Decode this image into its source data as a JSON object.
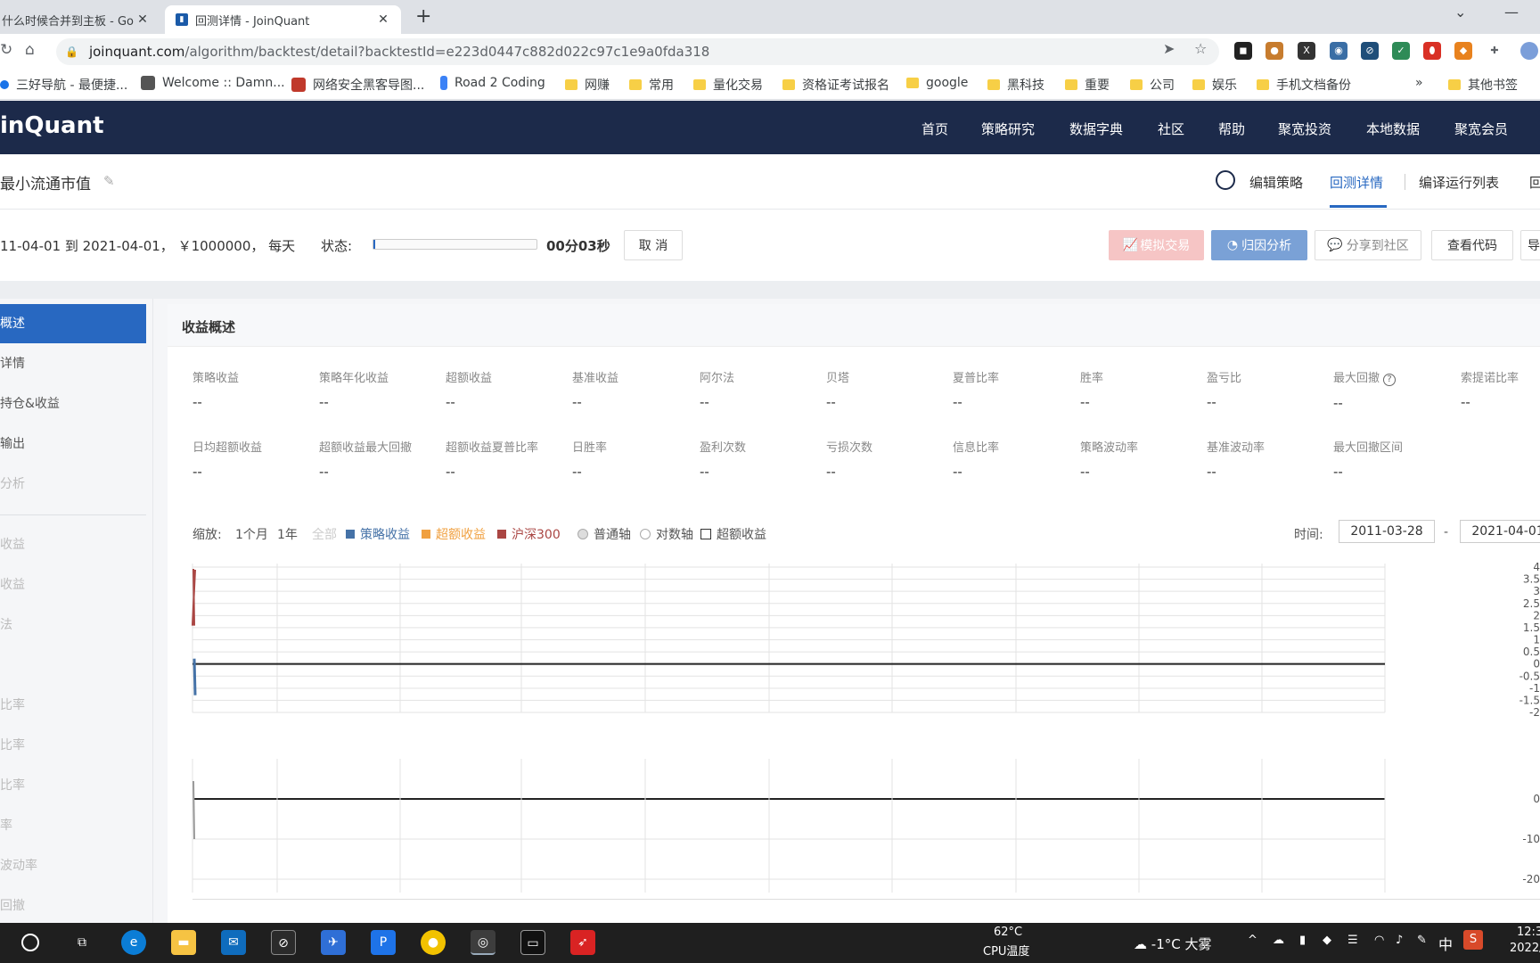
{
  "browser": {
    "tabs": [
      {
        "title": "什么时候合并到主板 - Go"
      },
      {
        "title": "回测详情 - JoinQuant"
      }
    ],
    "url_host": "joinquant.com",
    "url_path": "/algorithm/backtest/detail?backtestId=e223d0447c882d022c97c1e9a0fda318",
    "bookmarks": [
      "三好导航 - 最便捷...",
      "Welcome :: Damn...",
      "网络安全黑客导图...",
      "Road 2 Coding",
      "网赚",
      "常用",
      "量化交易",
      "资格证考试报名",
      "google",
      "黑科技",
      "重要",
      "公司",
      "娱乐",
      "手机文档备份",
      "其他书签"
    ],
    "more_bookmarks": "»"
  },
  "site": {
    "logo": "inQuant",
    "nav": [
      "首页",
      "策略研究",
      "数据字典",
      "社区",
      "帮助",
      "聚宽投资",
      "本地数据",
      "聚宽会员"
    ]
  },
  "strategy": {
    "title": "最小流通市值",
    "tabs": [
      "编辑策略",
      "回测详情",
      "编译运行列表",
      "回"
    ]
  },
  "controls": {
    "params": "11-04-01 到 2021-04-01， ￥1000000， 每天",
    "status_label": "状态:",
    "progress": 0.01,
    "elapsed": "00分03秒",
    "cancel": "取 消",
    "sim_trade": "模拟交易",
    "attribution": "归因分析",
    "share": "分享到社区",
    "view_code": "查看代码",
    "more": "导"
  },
  "sidebar": {
    "items": [
      "概述",
      "详情",
      "持仓&收益",
      "输出",
      "分析"
    ],
    "items2": [
      "收益",
      "收益",
      "法",
      "",
      "比率",
      "比率",
      "比率",
      "率",
      "波动率",
      "回撤"
    ]
  },
  "summary": {
    "title": "收益概述",
    "row1": [
      {
        "label": "策略收益",
        "value": "--"
      },
      {
        "label": "策略年化收益",
        "value": "--"
      },
      {
        "label": "超额收益",
        "value": "--"
      },
      {
        "label": "基准收益",
        "value": "--"
      },
      {
        "label": "阿尔法",
        "value": "--"
      },
      {
        "label": "贝塔",
        "value": "--"
      },
      {
        "label": "夏普比率",
        "value": "--"
      },
      {
        "label": "胜率",
        "value": "--"
      },
      {
        "label": "盈亏比",
        "value": "--"
      },
      {
        "label": "最大回撤",
        "value": "--"
      },
      {
        "label": "索提诺比率",
        "value": "--"
      }
    ],
    "row2": [
      {
        "label": "日均超额收益",
        "value": "--"
      },
      {
        "label": "超额收益最大回撤",
        "value": "--"
      },
      {
        "label": "超额收益夏普比率",
        "value": "--"
      },
      {
        "label": "日胜率",
        "value": "--"
      },
      {
        "label": "盈利次数",
        "value": "--"
      },
      {
        "label": "亏损次数",
        "value": "--"
      },
      {
        "label": "信息比率",
        "value": "--"
      },
      {
        "label": "策略波动率",
        "value": "--"
      },
      {
        "label": "基准波动率",
        "value": "--"
      },
      {
        "label": "最大回撤区间",
        "value": "--"
      }
    ],
    "help_icon": "?"
  },
  "chart_controls": {
    "zoom_label": "缩放:",
    "zoom_options": [
      "1个月",
      "1年",
      "全部"
    ],
    "legend": [
      {
        "name": "策略收益",
        "color": "#4572a7"
      },
      {
        "name": "超额收益",
        "color": "#f0a040"
      },
      {
        "name": "沪深300",
        "color": "#aa4643"
      }
    ],
    "axis_normal": "普通轴",
    "axis_log": "对数轴",
    "excess_checkbox": "超额收益",
    "time_label": "时间:",
    "date_from": "2011-03-28",
    "date_sep": "-",
    "date_to": "2021-04-01"
  },
  "chart_data": {
    "type": "line",
    "y_ticks_top": [
      "4",
      "3.5",
      "3",
      "2.5",
      "2",
      "1.5",
      "1",
      "0.5",
      "0",
      "-0.5",
      "-1",
      "-1.5",
      "-2"
    ],
    "y_ticks_bottom": [
      "0",
      "-10",
      "-20"
    ]
  },
  "taskbar": {
    "cpu_temp": "62°C",
    "cpu_label": "CPU温度",
    "weather": "-1°C 大雾",
    "ime": "中",
    "time": "12:3",
    "date": "2022/"
  }
}
